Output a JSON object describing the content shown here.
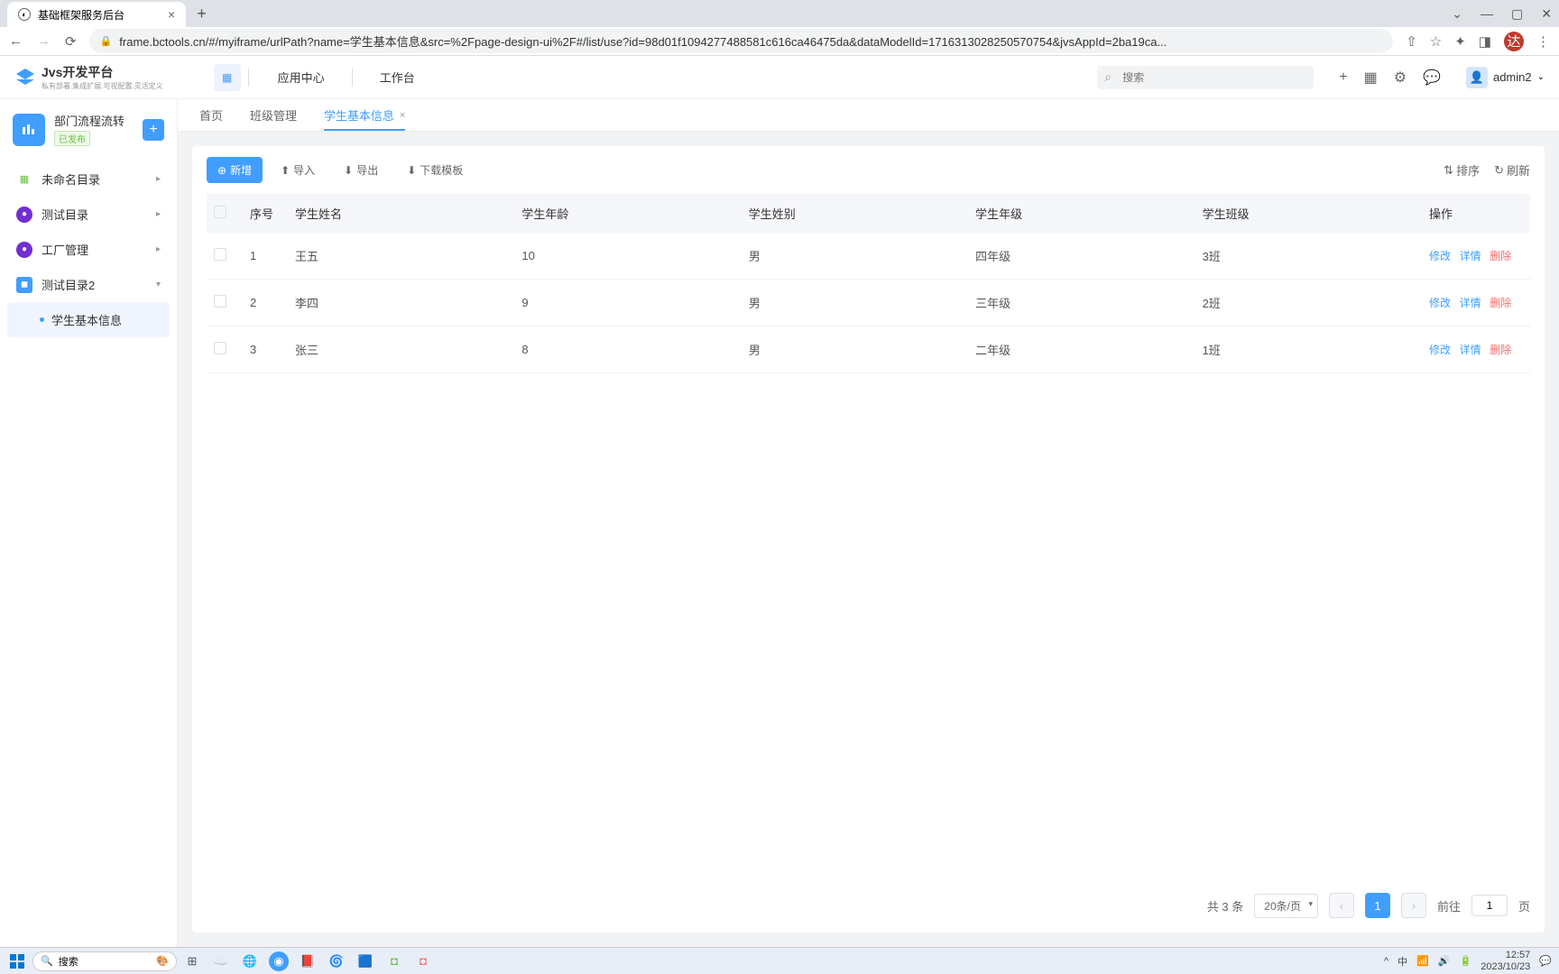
{
  "browser": {
    "tab_title": "基础框架服务后台",
    "url": "frame.bctools.cn/#/myiframe/urlPath?name=学生基本信息&src=%2Fpage-design-ui%2F#/list/use?id=98d01f1094277488581c616ca46475da&dataModelId=1716313028250570754&jvsAppId=2ba19ca..."
  },
  "header": {
    "logo_main": "Jvs开发平台",
    "logo_sub": "私有部署.集成扩展.可视配置.灵活定义",
    "nav": [
      "应用中心",
      "工作台"
    ],
    "search_placeholder": "搜索",
    "user": "admin2"
  },
  "sidebar": {
    "app_name": "部门流程流转",
    "app_badge": "已发布",
    "items": [
      {
        "label": "未命名目录",
        "expandable": true
      },
      {
        "label": "测试目录",
        "expandable": true
      },
      {
        "label": "工厂管理",
        "expandable": true
      },
      {
        "label": "测试目录2",
        "expandable": true,
        "expanded": true,
        "children": [
          {
            "label": "学生基本信息",
            "active": true
          }
        ]
      }
    ]
  },
  "tabs": [
    {
      "label": "首页",
      "closable": false
    },
    {
      "label": "班级管理",
      "closable": false
    },
    {
      "label": "学生基本信息",
      "closable": true,
      "active": true
    }
  ],
  "toolbar": {
    "add": "新增",
    "import": "导入",
    "export": "导出",
    "download_template": "下载模板",
    "sort": "排序",
    "refresh": "刷新"
  },
  "table": {
    "headers": [
      "序号",
      "学生姓名",
      "学生年龄",
      "学生姓别",
      "学生年级",
      "学生班级",
      "操作"
    ],
    "rows": [
      {
        "index": "1",
        "name": "王五",
        "age": "10",
        "gender": "男",
        "grade": "四年级",
        "class": "3班"
      },
      {
        "index": "2",
        "name": "李四",
        "age": "9",
        "gender": "男",
        "grade": "三年级",
        "class": "2班"
      },
      {
        "index": "3",
        "name": "张三",
        "age": "8",
        "gender": "男",
        "grade": "二年级",
        "class": "1班"
      }
    ],
    "actions": {
      "edit": "修改",
      "detail": "详情",
      "delete": "删除"
    }
  },
  "pagination": {
    "total_text": "共 3 条",
    "page_size": "20条/页",
    "current": "1",
    "goto_prefix": "前往",
    "goto_suffix": "页",
    "goto_value": "1"
  },
  "taskbar": {
    "search": "搜索",
    "time": "12:57",
    "date": "2023/10/23",
    "ime": "中"
  }
}
